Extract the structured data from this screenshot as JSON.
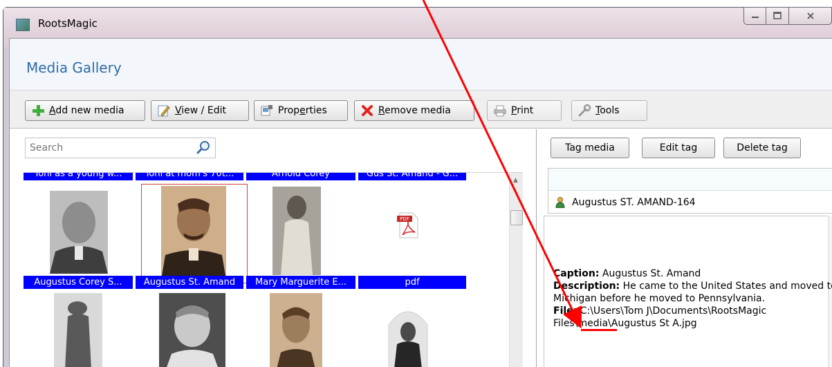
{
  "window": {
    "title": "RootsMagic",
    "controls": [
      "–",
      "□",
      "X"
    ]
  },
  "page": {
    "title": "Media Gallery"
  },
  "toolbar": {
    "add_media": {
      "pre": "",
      "key": "A",
      "post": "dd new media"
    },
    "view_edit": {
      "pre": "",
      "key": "V",
      "post": "iew / Edit"
    },
    "properties": {
      "pre": "Prop",
      "key": "e",
      "post": "rties"
    },
    "remove_media": {
      "pre": "",
      "key": "R",
      "post": "emove media"
    },
    "print": {
      "pre": "",
      "key": "P",
      "post": "rint"
    },
    "tools": {
      "pre": "",
      "key": "T",
      "post": "ools"
    }
  },
  "search": {
    "placeholder": "Search"
  },
  "gallery": {
    "top_row_labels": [
      "Toni as a young w...",
      "Toni at mom's 70t...",
      "Arnold Corey",
      "Gus St. Amand - G..."
    ],
    "middle_row_labels": [
      "Augustus Corey S...",
      "Augustus St. Amand",
      "Mary Marguerite E...",
      "pdf"
    ],
    "selected_index": 1
  },
  "tag_panel": {
    "buttons": {
      "tag_media": "Tag media",
      "edit_tag": "Edit tag",
      "delete_tag": "Delete tag"
    },
    "tagged_person": "Augustus ST. AMAND-164"
  },
  "details": {
    "caption_label": "Caption:",
    "caption_value": " Augustus St. Amand",
    "description_label": "Description:",
    "description_value": " He came to the United States and moved to Michigan before he moved to Pennsylvania.",
    "file_label": "File:",
    "file_value": " C:\\Users\\Tom J\\Documents\\RootsMagic Files\\media\\Augustus St A.jpg"
  },
  "colors": {
    "title_blue": "#2f6ba8",
    "selection_blue": "#0000ff",
    "annotation_red": "#ff0000"
  }
}
